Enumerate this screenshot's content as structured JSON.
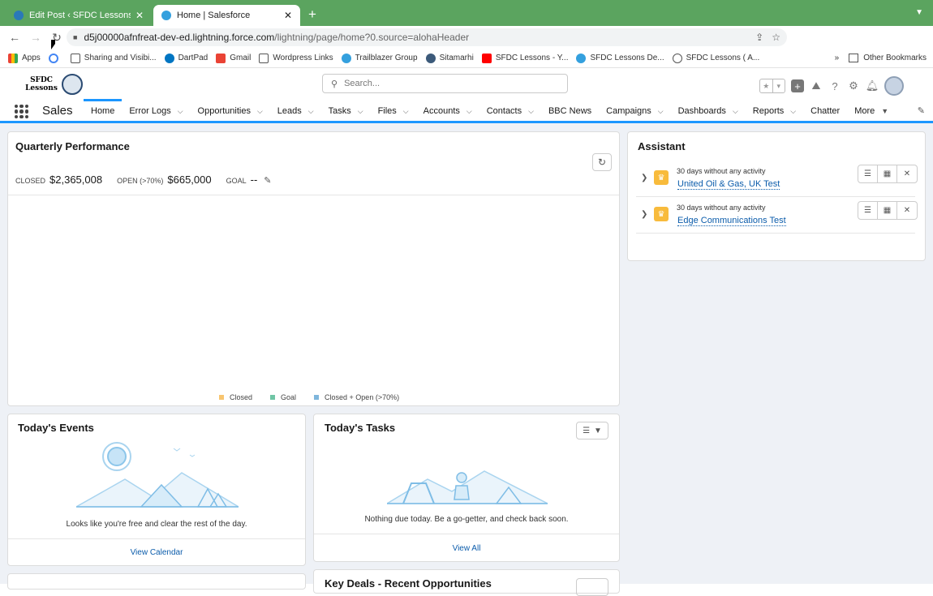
{
  "browser": {
    "tabs": [
      {
        "title": "Edit Post ‹ SFDC Lessons — W",
        "close": "✕"
      },
      {
        "title": "Home | Salesforce",
        "close": "✕"
      }
    ],
    "new_tab": "+",
    "url_host": "d5j00000afnfreat-dev-ed.lightning.force.com",
    "url_path": "/lightning/page/home?0.source=alohaHeader",
    "bookmarks": [
      "Apps",
      "Sharing and Visibi...",
      "DartPad",
      "Gmail",
      "Wordpress Links",
      "Trailblazer Group",
      "Sitamarhi",
      "SFDC Lessons - Y...",
      "SFDC Lessons De...",
      "SFDC Lessons ( A..."
    ],
    "more_bookmarks": "»",
    "other_bookmarks": "Other Bookmarks"
  },
  "header": {
    "logo_text": "SFDC Lessons",
    "search_placeholder": "Search..."
  },
  "appnav": {
    "app_name": "Sales",
    "items": [
      {
        "label": "Home"
      },
      {
        "label": "Error Logs"
      },
      {
        "label": "Opportunities"
      },
      {
        "label": "Leads"
      },
      {
        "label": "Tasks"
      },
      {
        "label": "Files"
      },
      {
        "label": "Accounts"
      },
      {
        "label": "Contacts"
      },
      {
        "label": "BBC News"
      },
      {
        "label": "Campaigns"
      },
      {
        "label": "Dashboards"
      },
      {
        "label": "Reports"
      },
      {
        "label": "Chatter"
      },
      {
        "label": "More"
      }
    ]
  },
  "quarterly": {
    "title": "Quarterly Performance",
    "closed_label": "CLOSED",
    "closed_value": "$2,365,008",
    "open_label": "OPEN (>70%)",
    "open_value": "$665,000",
    "goal_label": "GOAL",
    "goal_value": "--",
    "legend": [
      {
        "label": "Closed",
        "color": "#f8c56f"
      },
      {
        "label": "Goal",
        "color": "#6fc5a5"
      },
      {
        "label": "Closed + Open (>70%)",
        "color": "#7fb6dc"
      }
    ]
  },
  "assistant": {
    "title": "Assistant",
    "items": [
      {
        "message": "30 days without any activity",
        "link": "United Oil & Gas, UK Test"
      },
      {
        "message": "30 days without any activity",
        "link": "Edge Communications Test"
      }
    ]
  },
  "events": {
    "title": "Today's Events",
    "empty_message": "Looks like you're free and clear the rest of the day.",
    "footer_link": "View Calendar"
  },
  "tasks": {
    "title": "Today's Tasks",
    "empty_message": "Nothing due today. Be a go-getter, and check back soon.",
    "footer_link": "View All"
  },
  "key_deals": {
    "title": "Key Deals - Recent Opportunities"
  },
  "colors": {
    "brand_blue": "#1b96ff",
    "link_blue": "#0b5cab",
    "tab_bar_green": "#5ba45f"
  }
}
